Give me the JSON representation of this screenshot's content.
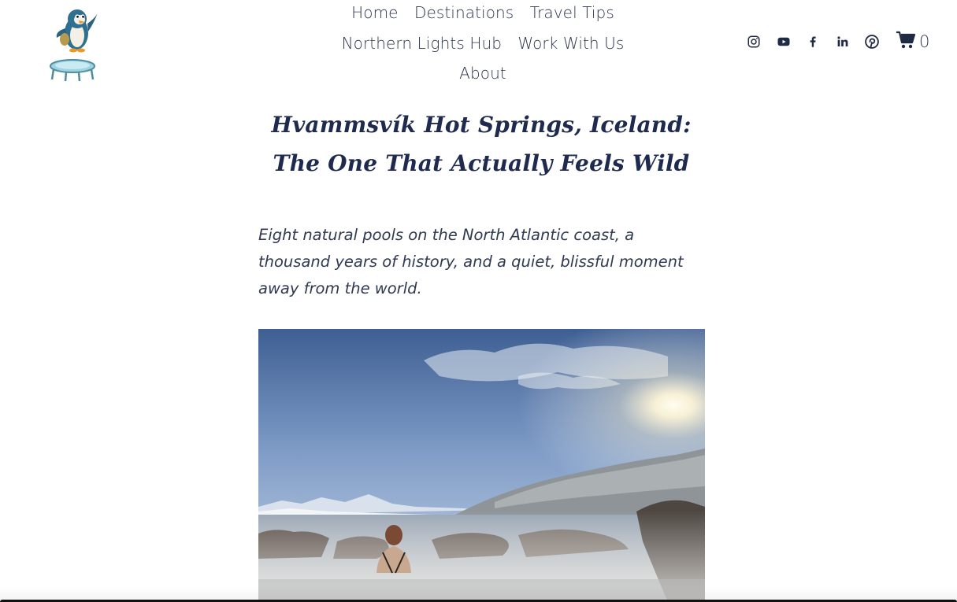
{
  "site": {
    "logo_name": "penguin-trampoline-logo"
  },
  "nav": {
    "rows": [
      [
        "Home",
        "Destinations",
        "Travel Tips"
      ],
      [
        "Northern Lights Hub",
        "Work With Us"
      ],
      [
        "About"
      ]
    ],
    "items": {
      "home": "Home",
      "destinations": "Destinations",
      "travel_tips": "Travel Tips",
      "northern_lights_hub": "Northern Lights Hub",
      "work_with_us": "Work With Us",
      "about": "About"
    }
  },
  "social": {
    "icons": [
      "instagram-icon",
      "youtube-icon",
      "facebook-icon",
      "linkedin-icon",
      "pinterest-icon"
    ]
  },
  "cart": {
    "icon": "cart-icon",
    "count": "0"
  },
  "article": {
    "title": "Hvammsvík Hot Springs, Iceland: The One That Actually Feels Wild",
    "subtitle": "Eight natural pools on the North Atlantic coast, a thousand years of history, and a quiet, blissful moment away from the world.",
    "hero_image": "woman-in-hot-spring-fjord-photo"
  },
  "colors": {
    "text_dark": "#1e2b4e",
    "nav_text": "#2b3550",
    "background": "#ffffff"
  }
}
